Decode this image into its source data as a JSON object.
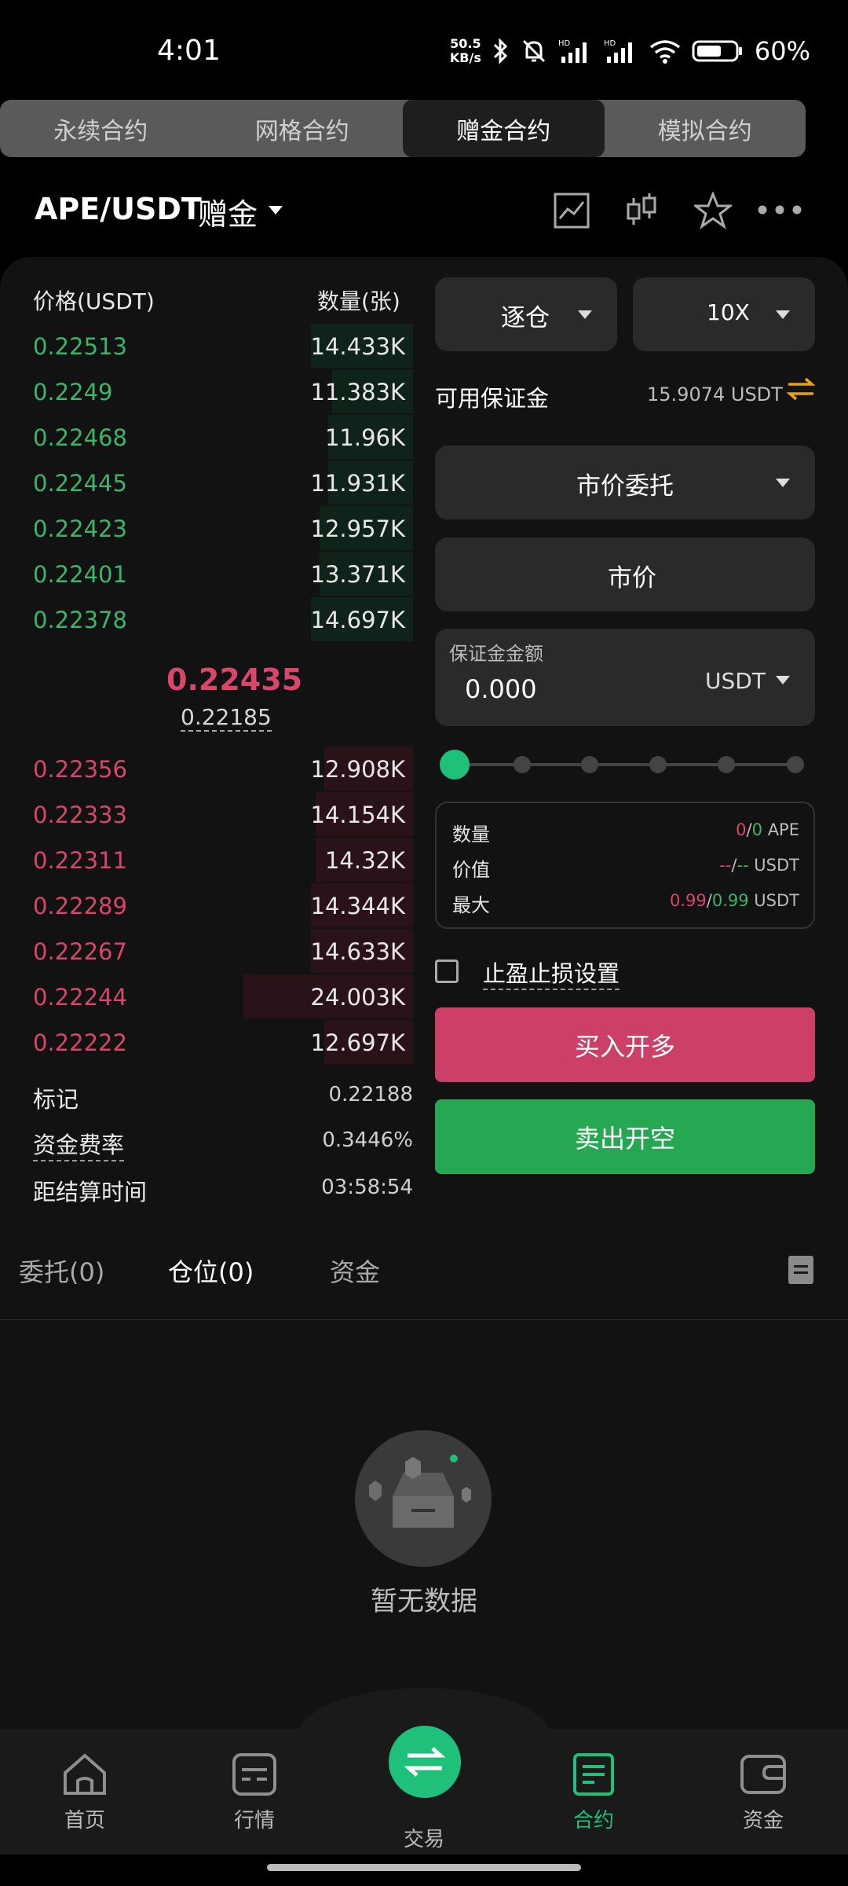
{
  "status_bar": {
    "time": "4:01",
    "net_speed_value": "50.5",
    "net_speed_unit": "KB/s",
    "battery": "60%"
  },
  "contract_tabs": [
    "永续合约",
    "网格合约",
    "赠金合约",
    "模拟合约"
  ],
  "pair": {
    "name": "APE/USDT",
    "tag": "赠金"
  },
  "order_book": {
    "price_header": "价格(USDT)",
    "qty_header": "数量(张)",
    "asks": [
      {
        "price": "0.22513",
        "qty": "14.433K",
        "depth": 0.24
      },
      {
        "price": "0.2249",
        "qty": "11.383K",
        "depth": 0.19
      },
      {
        "price": "0.22468",
        "qty": "11.96K",
        "depth": 0.2
      },
      {
        "price": "0.22445",
        "qty": "11.931K",
        "depth": 0.2
      },
      {
        "price": "0.22423",
        "qty": "12.957K",
        "depth": 0.22
      },
      {
        "price": "0.22401",
        "qty": "13.371K",
        "depth": 0.22
      },
      {
        "price": "0.22378",
        "qty": "14.697K",
        "depth": 0.24
      }
    ],
    "last_price": "0.22435",
    "mark_price": "0.22185",
    "bids": [
      {
        "price": "0.22356",
        "qty": "12.908K",
        "depth": 0.21
      },
      {
        "price": "0.22333",
        "qty": "14.154K",
        "depth": 0.23
      },
      {
        "price": "0.22311",
        "qty": "14.32K",
        "depth": 0.23
      },
      {
        "price": "0.22289",
        "qty": "14.344K",
        "depth": 0.24
      },
      {
        "price": "0.22267",
        "qty": "14.633K",
        "depth": 0.24
      },
      {
        "price": "0.22244",
        "qty": "24.003K",
        "depth": 0.4
      },
      {
        "price": "0.22222",
        "qty": "12.697K",
        "depth": 0.21
      }
    ]
  },
  "stats": [
    {
      "label": "标记",
      "value": "0.22188"
    },
    {
      "label": "资金费率",
      "value": "0.3446%"
    },
    {
      "label": "距结算时间",
      "value": "03:58:54"
    }
  ],
  "form": {
    "margin_mode": "逐仓",
    "leverage": "10X",
    "avail_label": "可用保证金",
    "avail_value": "15.9074 USDT",
    "order_type": "市价委托",
    "price_label": "市价",
    "amount_label": "保证金金额",
    "amount_value": "0.000",
    "amount_unit": "USDT",
    "slider_level": 0,
    "info": {
      "qty_label": "数量",
      "qty_a": "0",
      "qty_b": "0",
      "qty_unit": "APE",
      "value_label": "价值",
      "value_a": "--",
      "value_b": "--",
      "value_unit": "USDT",
      "max_label": "最大",
      "max_a": "0.99",
      "max_b": "0.99",
      "max_unit": "USDT"
    },
    "tpsl_label": "止盈止损设置",
    "buy_label": "买入开多",
    "sell_label": "卖出开空"
  },
  "position_tabs": {
    "orders": "委托(0)",
    "positions": "仓位(0)",
    "funds": "资金"
  },
  "empty_text": "暂无数据",
  "nav": {
    "home": "首页",
    "market": "行情",
    "trade": "交易",
    "contract": "合约",
    "assets": "资金"
  },
  "colors": {
    "green": "#1fc07a",
    "red": "#d9466a",
    "buy": "#cc3f66",
    "sell": "#26a853"
  }
}
